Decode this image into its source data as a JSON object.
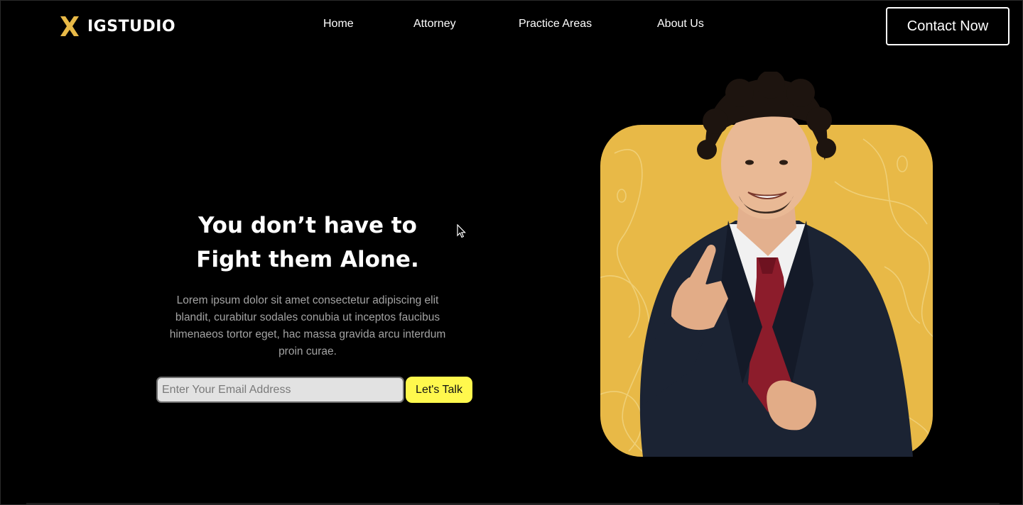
{
  "brand": {
    "name": "IGSTUDIO",
    "accent": "#e8b947"
  },
  "nav": {
    "items": [
      {
        "label": "Home"
      },
      {
        "label": "Attorney"
      },
      {
        "label": "Practice Areas"
      },
      {
        "label": "About Us"
      }
    ],
    "cta_label": "Contact Now"
  },
  "hero": {
    "title_line1": "You don’t have to",
    "title_line2": "Fight them Alone.",
    "description": "Lorem ipsum dolor sit amet consectetur adipiscing elit blandit, curabitur sodales conubia ut inceptos faucibus himenaeos tortor eget, hac massa gravida arcu interdum proin curae.",
    "email_placeholder": "Enter Your Email Address",
    "email_value": "",
    "submit_label": "Let's Talk",
    "submit_color": "#fff84d"
  },
  "photo": {
    "card_color": "#e8b947",
    "subject": "attorney pointing at viewer"
  }
}
